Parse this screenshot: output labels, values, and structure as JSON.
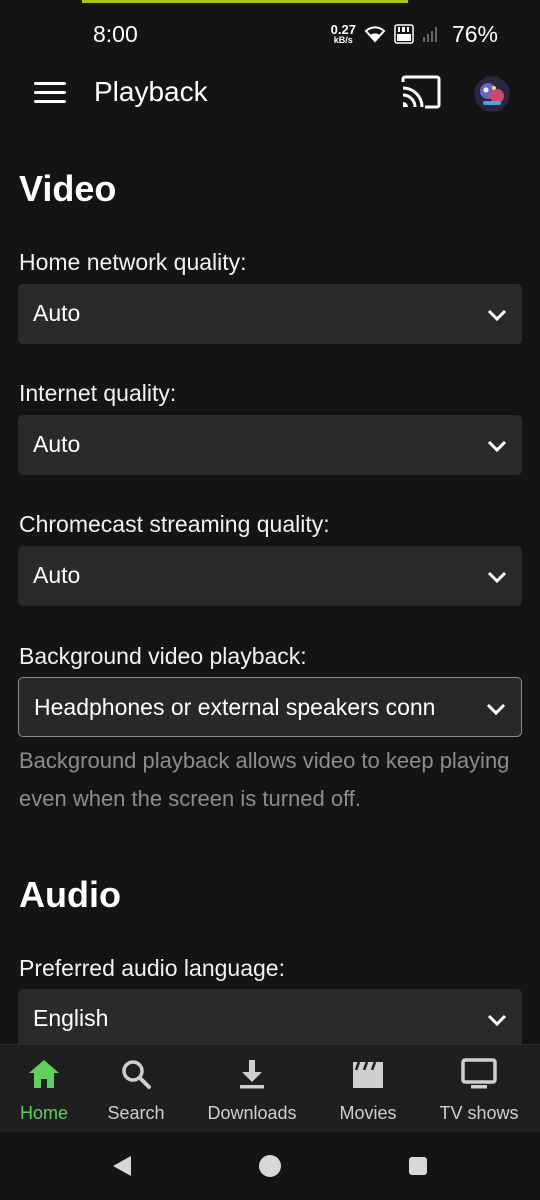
{
  "status_bar": {
    "time": "8:00",
    "net_speed_value": "0.27",
    "net_speed_unit": "kB/s",
    "battery": "76%",
    "icons": [
      "wifi-icon",
      "volte-icon",
      "signal-icon"
    ]
  },
  "app_bar": {
    "title": "Playback",
    "icons": [
      "menu-icon",
      "cast-icon",
      "avatar"
    ]
  },
  "video_section": {
    "title": "Video",
    "home_network": {
      "label": "Home network quality:",
      "value": "Auto"
    },
    "internet": {
      "label": "Internet quality:",
      "value": "Auto"
    },
    "chromecast": {
      "label": "Chromecast streaming quality:",
      "value": "Auto"
    },
    "background": {
      "label": "Background video playback:",
      "value": "Headphones or external speakers conn",
      "helper": "Background playback allows video to keep playing even when the screen is turned off."
    }
  },
  "audio_section": {
    "title": "Audio",
    "preferred_language": {
      "label": "Preferred audio language:",
      "value": "English"
    }
  },
  "bottom_nav": {
    "items": [
      {
        "label": "Home",
        "icon": "home-icon",
        "active": true
      },
      {
        "label": "Search",
        "icon": "search-icon",
        "active": false
      },
      {
        "label": "Downloads",
        "icon": "download-icon",
        "active": false
      },
      {
        "label": "Movies",
        "icon": "clapperboard-icon",
        "active": false
      },
      {
        "label": "TV shows",
        "icon": "tv-icon",
        "active": false
      }
    ]
  },
  "colors": {
    "background": "#141414",
    "select_background": "#2a2a2a",
    "accent_green": "#5fd05c",
    "helper_text": "#8c8c8c",
    "accent_line": "#a6c61a"
  }
}
